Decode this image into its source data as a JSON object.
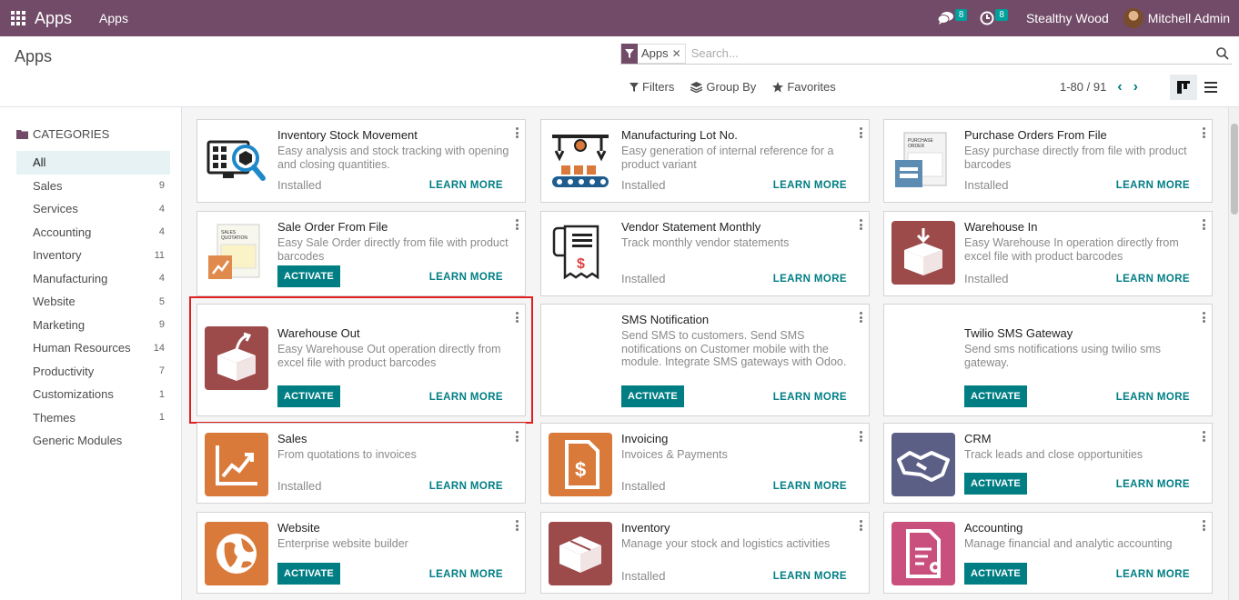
{
  "navbar": {
    "brand": "Apps",
    "menu_item": "Apps",
    "messages_count": "8",
    "activities_count": "8",
    "company": "Stealthy Wood",
    "user": "Mitchell Admin"
  },
  "control_panel": {
    "title": "Apps",
    "facet_label": "Apps",
    "search_placeholder": "Search...",
    "filters_label": "Filters",
    "group_by_label": "Group By",
    "favorites_label": "Favorites",
    "pager": "1-80 / 91"
  },
  "sidebar": {
    "header": "CATEGORIES",
    "items": [
      {
        "label": "All",
        "count": ""
      },
      {
        "label": "Sales",
        "count": "9"
      },
      {
        "label": "Services",
        "count": "4"
      },
      {
        "label": "Accounting",
        "count": "4"
      },
      {
        "label": "Inventory",
        "count": "11"
      },
      {
        "label": "Manufacturing",
        "count": "4"
      },
      {
        "label": "Website",
        "count": "5"
      },
      {
        "label": "Marketing",
        "count": "9"
      },
      {
        "label": "Human Resources",
        "count": "14"
      },
      {
        "label": "Productivity",
        "count": "7"
      },
      {
        "label": "Customizations",
        "count": "1"
      },
      {
        "label": "Themes",
        "count": "1"
      },
      {
        "label": "Generic Modules",
        "count": ""
      }
    ]
  },
  "labels": {
    "installed": "Installed",
    "activate": "ACTIVATE",
    "learn_more": "LEARN MORE"
  },
  "apps": [
    {
      "title": "Inventory Stock Movement",
      "desc": "Easy analysis and stock tracking with opening and closing quantities.",
      "installed": true,
      "icon": "stock-monitor-icon"
    },
    {
      "title": "Manufacturing Lot No.",
      "desc": "Easy generation of internal reference for a product variant",
      "installed": true,
      "icon": "conveyor-icon"
    },
    {
      "title": "Purchase Orders From File",
      "desc": "Easy purchase directly from file with product barcodes",
      "installed": true,
      "icon": "purchase-order-icon"
    },
    {
      "title": "Sale Order From File",
      "desc": "Easy Sale Order directly from file with product barcodes",
      "installed": false,
      "icon": "sales-quotation-icon"
    },
    {
      "title": "Vendor Statement Monthly",
      "desc": "Track monthly vendor statements",
      "installed": true,
      "icon": "statement-icon"
    },
    {
      "title": "Warehouse In",
      "desc": "Easy Warehouse In operation directly from excel file with product barcodes",
      "installed": true,
      "icon": "box-in-icon"
    },
    {
      "title": "Warehouse Out",
      "desc": "Easy Warehouse Out operation directly from excel file with product barcodes",
      "installed": false,
      "icon": "box-out-icon"
    },
    {
      "title": "SMS Notification",
      "desc": "Send SMS to customers. Send SMS notifications on Customer mobile with the module. Integrate SMS gateways with Odoo.",
      "installed": false,
      "icon": "sms-icon"
    },
    {
      "title": "Twilio SMS Gateway",
      "desc": "Send sms notifications using twilio sms gateway.",
      "installed": false,
      "icon": "twilio-icon"
    },
    {
      "title": "Sales",
      "desc": "From quotations to invoices",
      "installed": true,
      "icon": "sales-chart-icon"
    },
    {
      "title": "Invoicing",
      "desc": "Invoices & Payments",
      "installed": true,
      "icon": "invoice-icon"
    },
    {
      "title": "CRM",
      "desc": "Track leads and close opportunities",
      "installed": false,
      "icon": "handshake-icon"
    },
    {
      "title": "Website",
      "desc": "Enterprise website builder",
      "installed": false,
      "icon": "globe-icon"
    },
    {
      "title": "Inventory",
      "desc": "Manage your stock and logistics activities",
      "installed": true,
      "icon": "box-icon"
    },
    {
      "title": "Accounting",
      "desc": "Manage financial and analytic accounting",
      "installed": false,
      "icon": "accounting-doc-icon"
    }
  ],
  "colors": {
    "navbar": "#714b67",
    "primary": "#017e84",
    "highlight": "#e02020"
  }
}
